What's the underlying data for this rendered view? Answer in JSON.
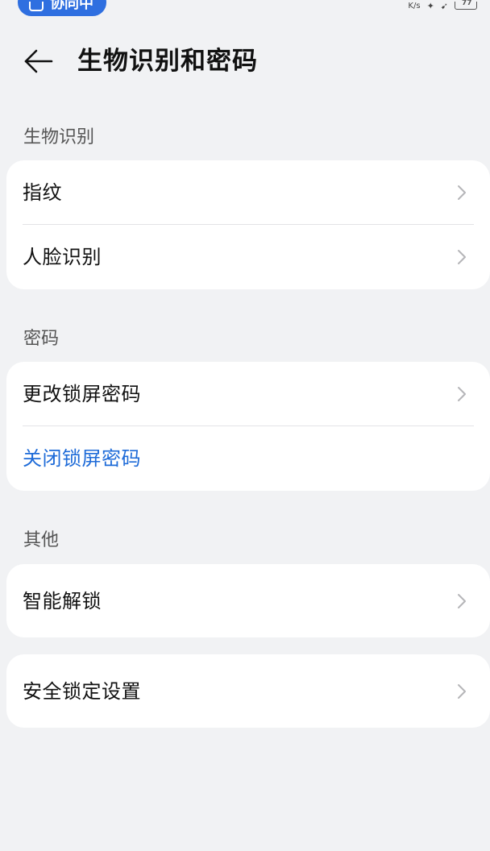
{
  "status_bar": {
    "collab_label": "协同中",
    "net_speed": "K/s",
    "battery_level": "77"
  },
  "header": {
    "title": "生物识别和密码"
  },
  "sections": {
    "biometrics": {
      "label": "生物识别",
      "items": [
        {
          "label": "指纹"
        },
        {
          "label": "人脸识别"
        }
      ]
    },
    "password": {
      "label": "密码",
      "items": [
        {
          "label": "更改锁屏密码"
        },
        {
          "label": "关闭锁屏密码"
        }
      ]
    },
    "other": {
      "label": "其他",
      "items": [
        {
          "label": "智能解锁"
        }
      ]
    },
    "security": {
      "items": [
        {
          "label": "安全锁定设置"
        }
      ]
    }
  },
  "colors": {
    "background": "#f1f2f4",
    "card": "#ffffff",
    "accent": "#1e6bd8",
    "pill": "#2f6fe0"
  }
}
